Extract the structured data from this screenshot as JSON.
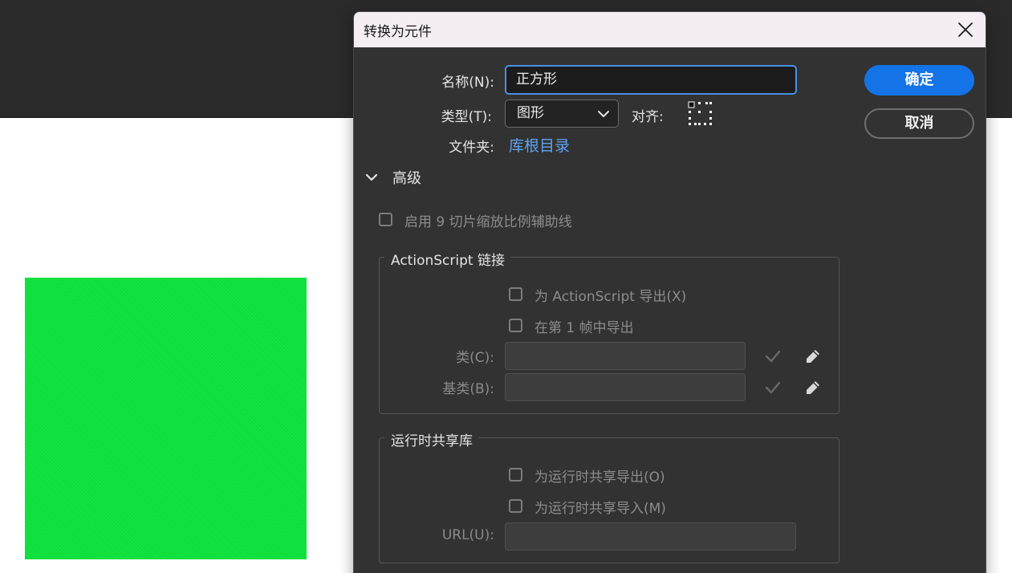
{
  "dialog": {
    "title": "转换为元件",
    "name_label": "名称(N):",
    "name_value": "正方形",
    "type_label": "类型(T):",
    "type_value": "图形",
    "align_label": "对齐:",
    "folder_label": "文件夹:",
    "folder_value": "库根目录",
    "advanced_label": "高级",
    "nine_slice_label": "启用 9 切片缩放比例辅助线",
    "ok_label": "确定",
    "cancel_label": "取消"
  },
  "actionscript": {
    "title": "ActionScript 链接",
    "export_label": "为 ActionScript 导出(X)",
    "frame1_label": "在第 1 帧中导出",
    "class_label": "类(C):",
    "class_value": "",
    "base_label": "基类(B):",
    "base_value": ""
  },
  "runtime": {
    "title": "运行时共享库",
    "export_label": "为运行时共享导出(O)",
    "import_label": "为运行时共享导入(M)",
    "url_label": "URL(U):",
    "url_value": ""
  },
  "colors": {
    "accent": "#1473e6",
    "link": "#5fa3ef",
    "shape_fill": "#11e53f",
    "dialog_bg": "#323232",
    "app_bg": "#2a2a2a"
  },
  "icons": {
    "close": "close-icon",
    "dropdown": "chevron-down-icon",
    "expand": "chevron-down-icon",
    "validate": "check-icon",
    "edit": "pencil-icon",
    "align": "registration-grid-icon"
  }
}
